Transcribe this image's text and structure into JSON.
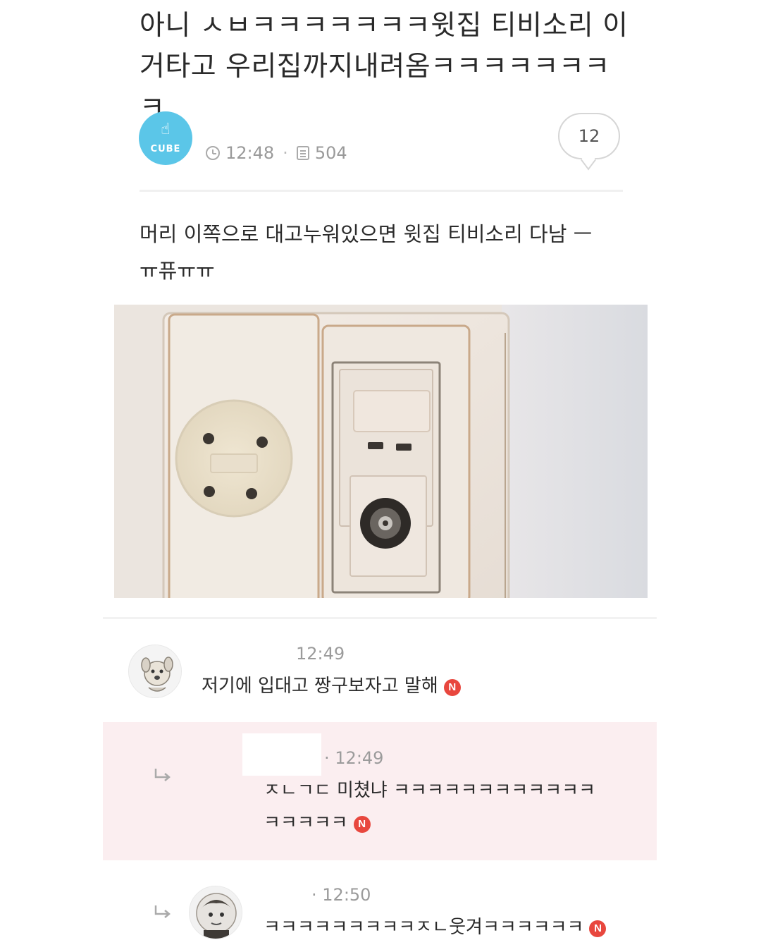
{
  "post": {
    "title_line1": "아니 ㅅㅂㅋㅋㅋㅋㅋㅋㅋ윗집 티비소리 이",
    "title_line2": "거타고 우리집까지내려옴ㅋㅋㅋㅋㅋㅋㅋㅋ",
    "author_avatar_label": "CUBE",
    "time": "12:48",
    "views": "504",
    "comment_count": "12",
    "body_line1": "머리 이쪽으로 대고누워있으면 윗집 티비소리 다남 ㅡ",
    "body_line2": "ㅠ퓨ㅠㅠ",
    "photo_subject": "wall-outlet-and-tv-antenna-jack"
  },
  "comments": [
    {
      "time": "12:49",
      "text": "저기에 입대고 짱구보자고 말해",
      "badge": "N"
    },
    {
      "time": "12:49",
      "text_line1": "ㅈㄴㄱㄷ 미쳤냐 ㅋㅋㅋㅋㅋㅋㅋㅋㅋㅋㅋㅋ",
      "text_line2": "ㅋㅋㅋㅋㅋ",
      "badge": "N",
      "highlight_color": "#fbeef0"
    },
    {
      "time": "12:50",
      "text": "ㅋㅋㅋㅋㅋㅋㅋㅋㅋㅈㄴ웃겨ㅋㅋㅋㅋㅋㅋ",
      "badge": "N"
    }
  ],
  "colors": {
    "accent_avatar": "#5bc6e8",
    "new_badge": "#e8473e"
  }
}
